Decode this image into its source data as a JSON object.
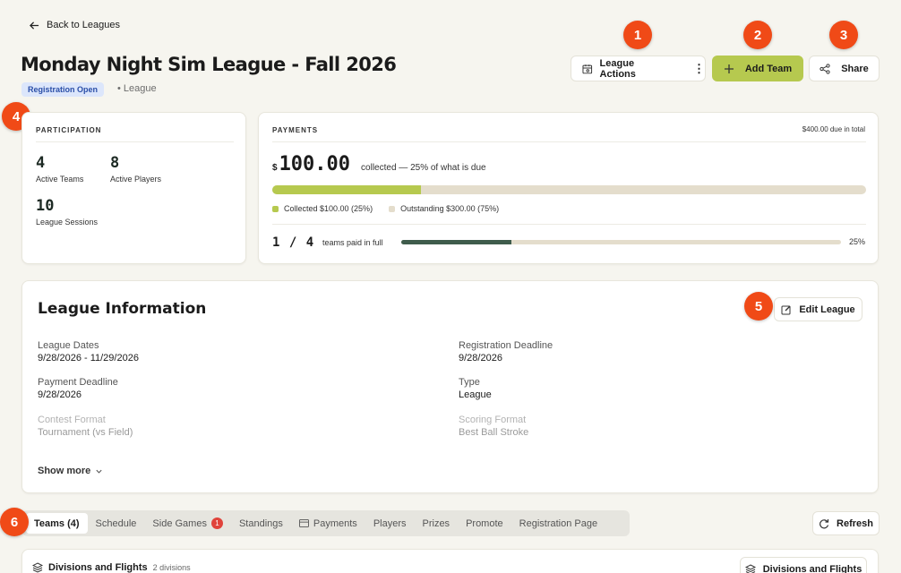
{
  "header": {
    "back_label": "Back to Leagues",
    "title": "Monday Night Sim League - Fall 2026",
    "status_badge": "Registration Open",
    "subtitle": "• League",
    "actions": {
      "league_actions": "League Actions",
      "add_team": "Add Team",
      "share": "Share"
    }
  },
  "markers": [
    "1",
    "2",
    "3",
    "4",
    "5",
    "6"
  ],
  "participation": {
    "caption": "PARTICIPATION",
    "stats": [
      {
        "value": "4",
        "label": "Active Teams"
      },
      {
        "value": "8",
        "label": "Active Players"
      },
      {
        "value": "10",
        "label": "League Sessions"
      }
    ]
  },
  "payments": {
    "caption": "PAYMENTS",
    "due_total": "$400.00 due in total",
    "currency": "$",
    "amount": "100.00",
    "amount_note": "collected — 25% of what is due",
    "collected_fraction": 0.25,
    "legend_collected": "Collected $100.00 (25%)",
    "legend_outstanding": "Outstanding $300.00 (75%)",
    "teams_paid": "1 / 4",
    "teams_paid_label": "teams paid in full",
    "teams_paid_fraction": 0.25,
    "teams_paid_pct": "25%",
    "colors": {
      "collected": "#b6c94f",
      "outstanding": "#e4ddcc",
      "teams_bar": "#3f5c4c"
    }
  },
  "league_info": {
    "title": "League Information",
    "edit_label": "Edit League",
    "fields_left": [
      {
        "label": "League Dates",
        "value": "9/28/2026 - 11/29/2026"
      },
      {
        "label": "Payment Deadline",
        "value": "9/28/2026"
      },
      {
        "label": "Contest Format",
        "value": "Tournament (vs Field)"
      }
    ],
    "fields_right": [
      {
        "label": "Registration Deadline",
        "value": "9/28/2026"
      },
      {
        "label": "Type",
        "value": "League"
      },
      {
        "label": "Scoring Format",
        "value": "Best Ball Stroke"
      }
    ],
    "show_more": "Show more"
  },
  "tabs": [
    {
      "label": "Teams (4)",
      "active": true
    },
    {
      "label": "Schedule"
    },
    {
      "label": "Side Games",
      "badge": "1"
    },
    {
      "label": "Standings"
    },
    {
      "label": "Payments",
      "icon": "card-icon"
    },
    {
      "label": "Players"
    },
    {
      "label": "Prizes"
    },
    {
      "label": "Promote"
    },
    {
      "label": "Registration Page"
    }
  ],
  "refresh_label": "Refresh",
  "divisions": {
    "title": "Divisions and Flights",
    "count": "2 divisions",
    "button": "Divisions and Flights"
  }
}
